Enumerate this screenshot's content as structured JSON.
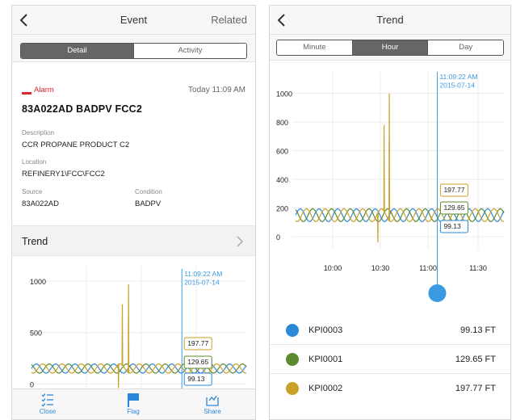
{
  "left": {
    "nav": {
      "title": "Event",
      "right": "Related"
    },
    "tabs": [
      {
        "label": "Detail",
        "active": true
      },
      {
        "label": "Activity",
        "active": false
      }
    ],
    "alarm": {
      "label": "Alarm",
      "time": "Today 11:09 AM",
      "color": "#e0242b"
    },
    "event_title": "83A022AD BADPV  FCC2",
    "description": {
      "label": "Description",
      "value": "CCR PROPANE PRODUCT C2"
    },
    "location": {
      "label": "Location",
      "value": "REFINERY1\\FCC\\FCC2"
    },
    "source": {
      "label": "Source",
      "value": "83A022AD"
    },
    "condition": {
      "label": "Condition",
      "value": "BADPV"
    },
    "trend_label": "Trend",
    "cursor": {
      "time": "11:09:22 AM",
      "date": "2015-07-14"
    },
    "toolbar": [
      {
        "label": "Close",
        "icon": "checklist-icon"
      },
      {
        "label": "Flag",
        "icon": "flag-icon"
      },
      {
        "label": "Share",
        "icon": "share-icon"
      }
    ]
  },
  "right": {
    "nav": {
      "title": "Trend"
    },
    "tabs": [
      {
        "label": "Minute",
        "active": false
      },
      {
        "label": "Hour",
        "active": true
      },
      {
        "label": "Day",
        "active": false
      }
    ],
    "cursor": {
      "time": "11:09:22 AM",
      "date": "2015-07-14"
    },
    "legend": [
      {
        "name": "KPI0003",
        "value": "99.13 FT",
        "color": "#2b88d8"
      },
      {
        "name": "KPI0001",
        "value": "129.65 FT",
        "color": "#5d8a2f"
      },
      {
        "name": "KPI0002",
        "value": "197.77 FT",
        "color": "#c9a227"
      }
    ]
  },
  "chart_data": [
    {
      "type": "line",
      "title": "",
      "xlabel": "",
      "ylabel": "",
      "yticks": [
        "0",
        "500",
        "1000"
      ],
      "ylim": [
        -60,
        1150
      ],
      "xlim": [
        0,
        100
      ],
      "grid": true,
      "series": [
        {
          "name": "KPI0003",
          "color": "#2b88d8",
          "base": 150,
          "amp": 45,
          "period": 9,
          "phase": 0.0
        },
        {
          "name": "KPI0001",
          "color": "#5d8a2f",
          "base": 150,
          "amp": 45,
          "period": 9,
          "phase": 2.1
        },
        {
          "name": "KPI0002",
          "color": "#c9a227",
          "base": 150,
          "amp": 45,
          "period": 9,
          "phase": 4.2,
          "spikes": [
            {
              "x": 42.3,
              "y": 775
            },
            {
              "x": 45.2,
              "y": 970
            }
          ],
          "dip": {
            "x": 40.5,
            "y": -40
          }
        }
      ],
      "cursor_x": 70,
      "callouts": [
        {
          "value": "197.77",
          "color": "#c9a227",
          "y": 197.77
        },
        {
          "value": "129.65",
          "color": "#5d8a2f",
          "y": 129.65
        },
        {
          "value": "99.13",
          "color": "#2b88d8",
          "y": 99.13
        }
      ]
    },
    {
      "type": "line",
      "title": "",
      "xlabel": "",
      "ylabel": "",
      "yticks": [
        "0",
        "200",
        "400",
        "600",
        "800",
        "1000"
      ],
      "xticks": [
        "10:00",
        "10:30",
        "11:00",
        "11:30"
      ],
      "ylim": [
        -90,
        1150
      ],
      "xlim": [
        0,
        100
      ],
      "grid": true,
      "series": [
        {
          "name": "KPI0003",
          "color": "#2b88d8",
          "base": 150,
          "amp": 45,
          "period": 9,
          "phase": 0.0
        },
        {
          "name": "KPI0001",
          "color": "#5d8a2f",
          "base": 150,
          "amp": 45,
          "period": 9,
          "phase": 2.1
        },
        {
          "name": "KPI0002",
          "color": "#c9a227",
          "base": 150,
          "amp": 45,
          "period": 9,
          "phase": 4.2,
          "spikes": [
            {
              "x": 42.5,
              "y": 780
            },
            {
              "x": 45.0,
              "y": 1000
            }
          ],
          "dip": {
            "x": 39.5,
            "y": -40
          }
        }
      ],
      "cursor_x": 68,
      "callouts": [
        {
          "value": "197.77",
          "color": "#c9a227",
          "y": 197.77
        },
        {
          "value": "129.65",
          "color": "#5d8a2f",
          "y": 129.65
        },
        {
          "value": "99.13",
          "color": "#2b88d8",
          "y": 99.13
        }
      ]
    }
  ]
}
